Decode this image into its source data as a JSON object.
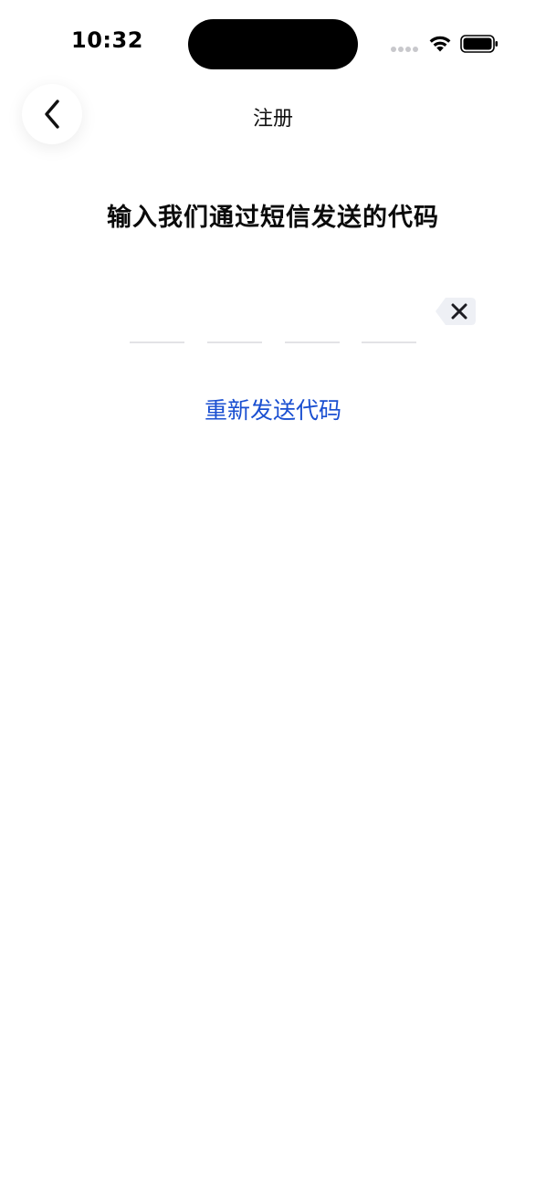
{
  "status_bar": {
    "time": "10:32"
  },
  "header": {
    "title": "注册",
    "back_icon": "chevron-left-icon"
  },
  "main": {
    "headline": "输入我们通过短信发送的代码",
    "code_digits": [
      "",
      "",
      "",
      ""
    ],
    "delete_icon": "backspace-icon",
    "resend_label": "重新发送代码"
  },
  "colors": {
    "link": "#1a4fd1",
    "slot_underline": "#e3e3e6",
    "delete_key_bg": "#eef0f5"
  }
}
